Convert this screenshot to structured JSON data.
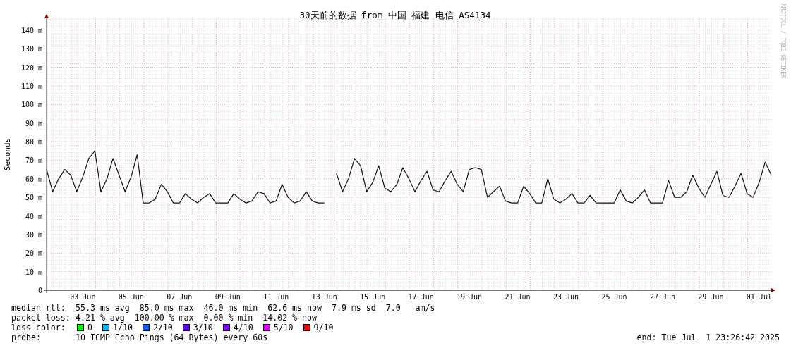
{
  "graph": {
    "title": "30天前的数据 from 中国 福建 电信 AS4134",
    "credit": "RRDTOOL / TOBI OETIKER",
    "chart_data": {
      "type": "line",
      "ylabel": "Seconds",
      "grid": true,
      "ylim": [
        0,
        146
      ],
      "yticks": [
        {
          "value": 0,
          "label": "0"
        },
        {
          "value": 10,
          "label": "10 m"
        },
        {
          "value": 20,
          "label": "20 m"
        },
        {
          "value": 30,
          "label": "30 m"
        },
        {
          "value": 40,
          "label": "40 m"
        },
        {
          "value": 50,
          "label": "50 m"
        },
        {
          "value": 60,
          "label": "60 m"
        },
        {
          "value": 70,
          "label": "70 m"
        },
        {
          "value": 80,
          "label": "80 m"
        },
        {
          "value": 90,
          "label": "90 m"
        },
        {
          "value": 100,
          "label": "100 m"
        },
        {
          "value": 110,
          "label": "110 m"
        },
        {
          "value": 120,
          "label": "120 m"
        },
        {
          "value": 130,
          "label": "130 m"
        },
        {
          "value": 140,
          "label": "140 m"
        }
      ],
      "categories": [
        null,
        null,
        null,
        null,
        null,
        null,
        "03 Jun",
        null,
        null,
        null,
        null,
        null,
        null,
        null,
        "05 Jun",
        null,
        null,
        null,
        null,
        null,
        null,
        null,
        "07 Jun",
        null,
        null,
        null,
        null,
        null,
        null,
        null,
        "09 Jun",
        null,
        null,
        null,
        null,
        null,
        null,
        null,
        "11 Jun",
        null,
        null,
        null,
        null,
        null,
        null,
        null,
        "13 Jun",
        null,
        null,
        null,
        null,
        null,
        null,
        null,
        "15 Jun",
        null,
        null,
        null,
        null,
        null,
        null,
        null,
        "17 Jun",
        null,
        null,
        null,
        null,
        null,
        null,
        null,
        "19 Jun",
        null,
        null,
        null,
        null,
        null,
        null,
        null,
        "21 Jun",
        null,
        null,
        null,
        null,
        null,
        null,
        null,
        "23 Jun",
        null,
        null,
        null,
        null,
        null,
        null,
        null,
        "25 Jun",
        null,
        null,
        null,
        null,
        null,
        null,
        null,
        "27 Jun",
        null,
        null,
        null,
        null,
        null,
        null,
        null,
        "29 Jun",
        null,
        null,
        null,
        null,
        null,
        null,
        null,
        "01 Jul",
        null,
        null
      ],
      "series": [
        {
          "color": "#111111",
          "values": [
            65,
            53,
            60,
            65,
            62,
            53,
            61,
            71,
            75,
            53,
            60,
            71,
            62,
            53,
            61,
            73,
            47,
            47,
            49,
            57,
            53,
            47,
            47,
            52,
            49,
            47,
            50,
            52,
            47,
            47,
            47,
            52,
            49,
            47,
            48,
            53,
            52,
            47,
            48,
            57,
            50,
            47,
            48,
            53,
            48,
            47,
            47,
            null,
            63,
            53,
            60,
            71,
            67,
            53,
            58,
            67,
            55,
            53,
            57,
            66,
            60,
            53,
            59,
            64,
            54,
            53,
            59,
            64,
            57,
            53,
            65,
            66,
            65,
            50,
            53,
            56,
            48,
            47,
            47,
            56,
            52,
            47,
            47,
            60,
            49,
            47,
            49,
            52,
            47,
            47,
            51,
            47,
            47,
            47,
            47,
            54,
            48,
            47,
            50,
            54,
            47,
            47,
            47,
            59,
            50,
            50,
            53,
            62,
            55,
            50,
            57,
            64,
            51,
            50,
            56,
            63,
            52,
            50,
            58,
            69,
            62
          ]
        }
      ]
    }
  },
  "stats": [
    {
      "label": "median rtt:",
      "text": "55.3 ms avg  85.0 ms max  46.0 ms min  62.6 ms now  7.9 ms sd  7.0   am/s"
    },
    {
      "label": "packet loss:",
      "text": "4.21 % avg  100.00 % max  0.00 % min  14.02 % now"
    }
  ],
  "loss_color": {
    "label": "loss color:",
    "items": [
      {
        "label": "0",
        "color": "#00ff00"
      },
      {
        "label": "1/10",
        "color": "#00b8ff"
      },
      {
        "label": "2/10",
        "color": "#0059ff"
      },
      {
        "label": "3/10",
        "color": "#5e00ff"
      },
      {
        "label": "4/10",
        "color": "#7e00ff"
      },
      {
        "label": "5/10",
        "color": "#dd00ff"
      },
      {
        "label": "9/10",
        "color": "#ff0000"
      }
    ]
  },
  "probe": {
    "label": "probe:",
    "text": "10 ICMP Echo Pings (64 Bytes) every 60s"
  },
  "end": "end: Tue Jul  1 23:26:42 2025"
}
